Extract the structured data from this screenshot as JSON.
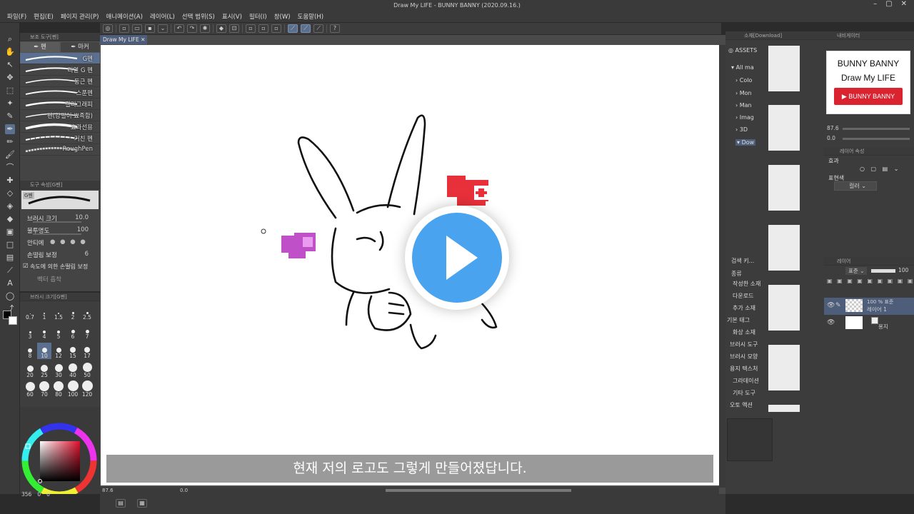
{
  "window": {
    "title": "Draw My LIFE - BUNNY BANNY (2020.09.16.)"
  },
  "menu": [
    {
      "label": "파일(F)"
    },
    {
      "label": "편집(E)"
    },
    {
      "label": "페이지 관리(P)"
    },
    {
      "label": "애니메이션(A)"
    },
    {
      "label": "레이어(L)"
    },
    {
      "label": "선택 범위(S)"
    },
    {
      "label": "표시(V)"
    },
    {
      "label": "필터(I)"
    },
    {
      "label": "창(W)"
    },
    {
      "label": "도움말(H)"
    }
  ],
  "document": {
    "tab": "Draw My LIFE"
  },
  "subtool": {
    "header": "보조 도구[펜]",
    "tabs": [
      {
        "label": "펜"
      },
      {
        "label": "마커"
      }
    ],
    "brushes": [
      {
        "name": "G펜"
      },
      {
        "name": "리얼 G 펜"
      },
      {
        "name": "둥근 펜"
      },
      {
        "name": "스푼펜"
      },
      {
        "name": "캘리그래피"
      },
      {
        "name": "펜(강필이 뾰족함)"
      },
      {
        "name": "효과선용"
      },
      {
        "name": "거친 펜"
      },
      {
        "name": "RoughPen"
      }
    ]
  },
  "tool_property": {
    "header": "도구 속성[G펜]",
    "preview_label": "G펜",
    "brush_size": {
      "label": "브러시 크기",
      "value": "10.0"
    },
    "opacity": {
      "label": "불투명도",
      "value": "100"
    },
    "antialias": {
      "label": "안티에"
    },
    "stabilization": {
      "label": "손떨림 보정",
      "value": "6"
    },
    "speed_stab": {
      "label": "속도에 의한 손떨림 보정"
    },
    "vector": {
      "label": "벡터 흡착"
    }
  },
  "brush_size_panel": {
    "header": "브러시 크기[G펜]",
    "sizes": [
      "0.7",
      "1",
      "1.5",
      "2",
      "2.5",
      "3",
      "4",
      "5",
      "6",
      "7",
      "8",
      "10",
      "12",
      "15",
      "17",
      "20",
      "25",
      "30",
      "40",
      "50",
      "60",
      "70",
      "80",
      "100",
      "120"
    ]
  },
  "color_panel": {
    "readout_1": "356",
    "readout_2": "0",
    "readout_3": "0"
  },
  "canvas": {
    "caption": "현재 저의 로고도 그렇게 만들어졌답니다.",
    "zoom": "87.6",
    "angle": "0.0"
  },
  "assets": {
    "header": "소재[Download]",
    "tab": "ASSETS",
    "tree": [
      {
        "label": "All ma"
      },
      {
        "label": "Colo"
      },
      {
        "label": "Mon"
      },
      {
        "label": "Man"
      },
      {
        "label": "Imag"
      },
      {
        "label": "3D"
      },
      {
        "label": "Dow"
      }
    ],
    "search_header": "검색 키...",
    "categories_header": "종류",
    "categories": [
      {
        "label": "작성한 소재"
      },
      {
        "label": "다운로드"
      },
      {
        "label": "추가 소재"
      }
    ],
    "tags_header": "기본 태그",
    "tags": [
      {
        "label": "화상 소재"
      },
      {
        "label": "브러시 도구"
      },
      {
        "label": "브러시 모양"
      },
      {
        "label": "용지 텍스처"
      },
      {
        "label": "그라데이션"
      },
      {
        "label": "기타 도구"
      },
      {
        "label": "오토 액션"
      }
    ]
  },
  "navigator": {
    "header": "내비게이터",
    "logo_line1": "BUNNY BANNY",
    "logo_line2": "Draw My LIFE",
    "logo_button": "BUNNY BANNY",
    "zoom": "87.6",
    "angle": "0.0"
  },
  "layer_property": {
    "header": "레이어 속성",
    "effect_label": "효과",
    "expression_label": "표현색",
    "expression_value": "컬러"
  },
  "layers": {
    "header": "레이어",
    "blend": "표준",
    "opacity": "100",
    "items": [
      {
        "meta": "100 % 표준",
        "name": "레이어 1"
      },
      {
        "name": "용지"
      }
    ]
  },
  "colors": {
    "accent": "#5b6f8e",
    "play": "#4aa3ef",
    "logo_red": "#d9232e"
  }
}
